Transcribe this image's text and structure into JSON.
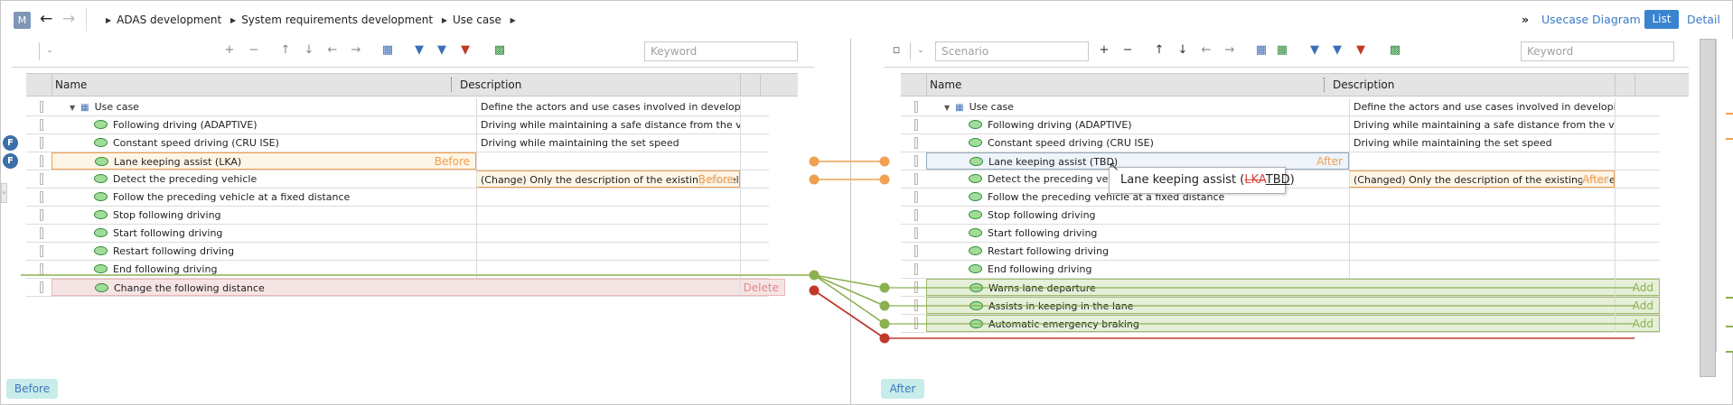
{
  "topbar": {
    "app_initial": "M",
    "breadcrumb": [
      "ADAS development",
      "System requirements development",
      "Use case"
    ],
    "more": "»",
    "views": {
      "diagram": "Usecase Diagram",
      "list": "List",
      "detail": "Detail"
    }
  },
  "left": {
    "keyword_placeholder": "Keyword",
    "columns": {
      "name": "Name",
      "description": "Description"
    },
    "rows": [
      {
        "name": "Use case",
        "description": "Define the actors and use cases involved in developing a···",
        "kind": "root"
      },
      {
        "name": "Following driving (ADAPTIVE)",
        "description": "Driving while maintaining a safe distance from the vehicl···"
      },
      {
        "name": "Constant speed driving (CRU ISE)",
        "description": "Driving while maintaining the set speed",
        "badge": "F"
      },
      {
        "name": "Lane keeping assist (LKA)",
        "description": "",
        "badge": "F",
        "tag": "Before",
        "state": "before"
      },
      {
        "name": "Detect the preceding vehicle",
        "description": "(Change) Only the description of the existing model has",
        "desc_tag": "Before",
        "state": "descbefore"
      },
      {
        "name": "Follow the preceding vehicle at a fixed distance",
        "description": ""
      },
      {
        "name": "Stop following driving",
        "description": ""
      },
      {
        "name": "Start following driving",
        "description": ""
      },
      {
        "name": "Restart following driving",
        "description": ""
      },
      {
        "name": "End following driving",
        "description": ""
      },
      {
        "name": "Change the following distance",
        "description": "",
        "tag": "Delete",
        "state": "delete"
      }
    ],
    "label": "Before"
  },
  "right": {
    "scenario_placeholder": "Scenario",
    "keyword_placeholder": "Keyword",
    "columns": {
      "name": "Name",
      "description": "Description"
    },
    "rows": [
      {
        "name": "Use case",
        "description": "Define the actors and use cases involved in developing a···",
        "kind": "root"
      },
      {
        "name": "Following driving (ADAPTIVE)",
        "description": "Driving while maintaining a safe distance from the vehicl···"
      },
      {
        "name": "Constant speed driving (CRU ISE)",
        "description": "Driving while maintaining the set speed"
      },
      {
        "name": "Lane keeping assist (TBD)",
        "description": "",
        "tag": "After",
        "state": "after"
      },
      {
        "name": "Detect the preceding vehicle",
        "description": "(Changed) Only the description of the existing model is",
        "desc_tag": "After",
        "state": "descafter"
      },
      {
        "name": "Follow the preceding vehicle at a fixed distance",
        "description": ""
      },
      {
        "name": "Stop following driving",
        "description": ""
      },
      {
        "name": "Start following driving",
        "description": ""
      },
      {
        "name": "Restart following driving",
        "description": ""
      },
      {
        "name": "End following driving",
        "description": ""
      },
      {
        "name": "Warns lane departure",
        "description": "",
        "tag": "Add",
        "state": "add"
      },
      {
        "name": "Assists in keeping in the lane",
        "description": "",
        "tag": "Add",
        "state": "add"
      },
      {
        "name": "Automatic emergency braking",
        "description": "",
        "tag": "Add",
        "state": "add"
      }
    ],
    "label": "After"
  },
  "tooltip": {
    "prefix": "Lane keeping assist (",
    "removed": "LKA",
    "added": "TBD",
    "suffix": ")"
  },
  "colors": {
    "before": "#f0a050",
    "delete": "#c0392b",
    "add": "#8bb050",
    "accent": "#3a84cf"
  }
}
